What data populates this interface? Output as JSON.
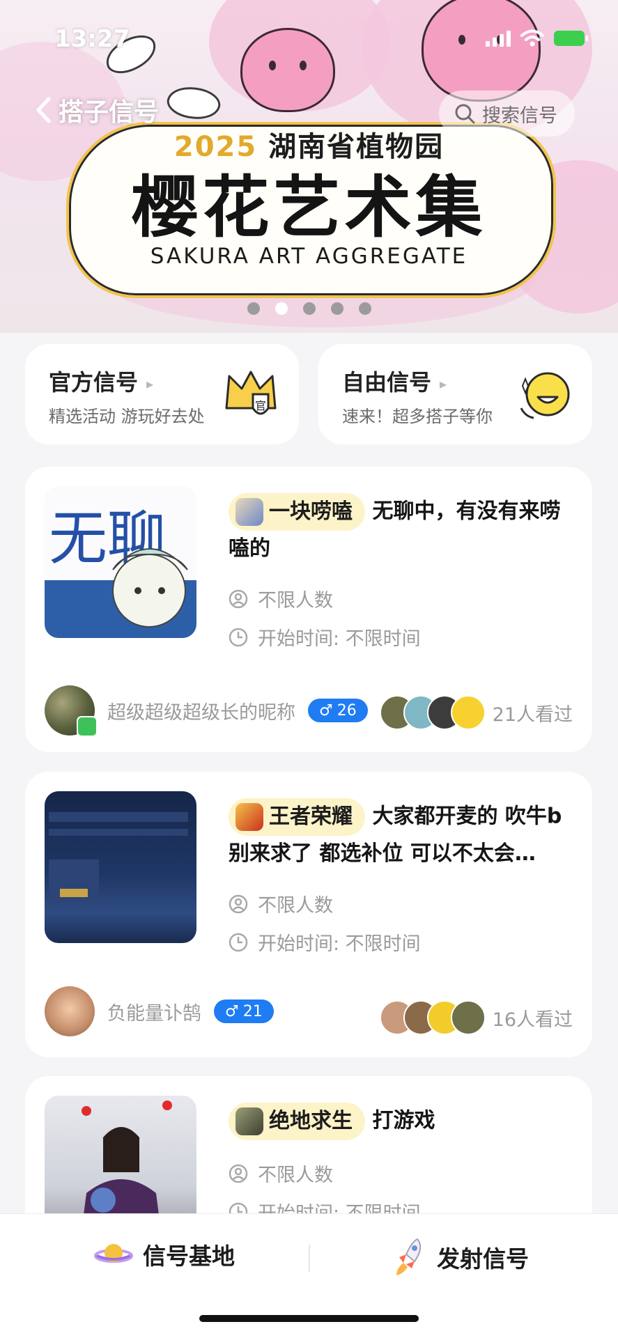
{
  "status_bar": {
    "time": "13:27"
  },
  "banner": {
    "year": "2025",
    "venue": "湖南省植物园",
    "title": "樱花艺术集",
    "subtitle_en": "SAKURA ART AGGREGATE",
    "carousel": {
      "count": 5,
      "active_index": 1
    }
  },
  "nav": {
    "back_label": "搭子信号"
  },
  "search": {
    "placeholder": "搜索信号"
  },
  "quick_cards": [
    {
      "title": "官方信号",
      "subtitle": "精选活动 游玩好去处",
      "badge": "官"
    },
    {
      "title": "自由信号",
      "subtitle": "速来！超多搭子等你"
    }
  ],
  "feed": [
    {
      "tag": "一块唠嗑",
      "headline_text": "无聊中，有没有来唠嗑的",
      "capacity": "不限人数",
      "start_time": "开始时间: 不限时间",
      "author_name": "超级超级超级长的昵称",
      "gender_symbol": "♂",
      "age": "26",
      "viewers_text": "21人看过",
      "thumb_text": "无聊"
    },
    {
      "tag": "王者荣耀",
      "headline_text": "大家都开麦的 吹牛b别来求了 都选补位 可以不太会…",
      "capacity": "不限人数",
      "start_time": "开始时间: 不限时间",
      "author_name": "负能量讣鹄",
      "gender_symbol": "♂",
      "age": "21",
      "viewers_text": "16人看过"
    },
    {
      "tag": "绝地求生",
      "headline_text": "打游戏",
      "capacity": "不限人数",
      "start_time": "开始时间: 不限时间"
    }
  ],
  "tabbar": {
    "left_label": "信号基地",
    "right_label": "发射信号"
  },
  "colors": {
    "tag_bg": "#fdf3c8",
    "gender_blue": "#1f7cf3",
    "page_bg": "#f5f5f7"
  },
  "icons": [
    "chevron-left-icon",
    "search-icon",
    "crown-icon",
    "smiley-icon",
    "person-icon",
    "clock-icon",
    "planet-icon",
    "rocket-icon"
  ]
}
